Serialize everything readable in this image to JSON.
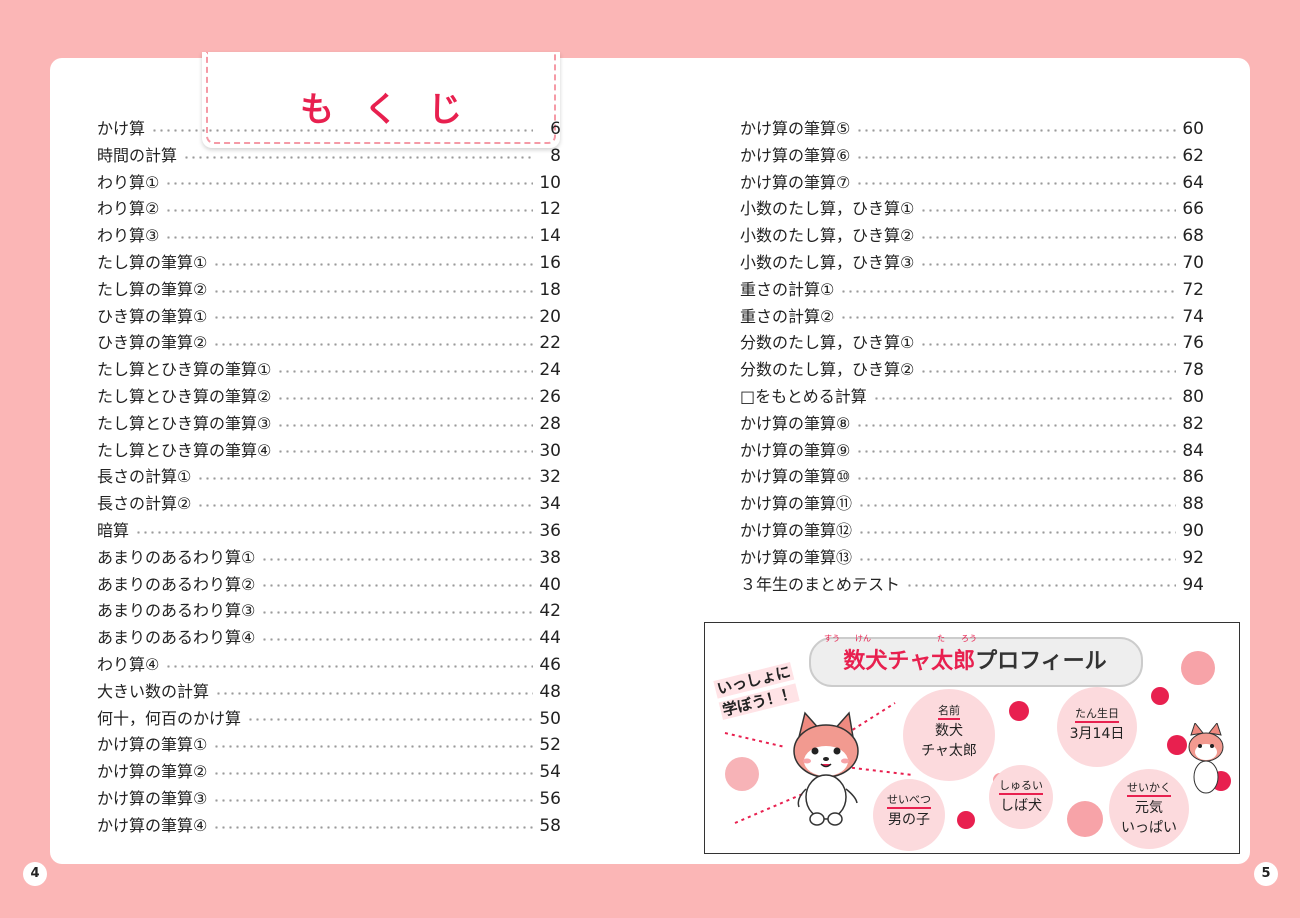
{
  "title": "もくじ",
  "left_page_number": "4",
  "right_page_number": "5",
  "toc_left": [
    {
      "label": "かけ算",
      "page": "6"
    },
    {
      "label": "時間の計算",
      "page": "8"
    },
    {
      "label": "わり算①",
      "page": "10"
    },
    {
      "label": "わり算②",
      "page": "12"
    },
    {
      "label": "わり算③",
      "page": "14"
    },
    {
      "label": "たし算の筆算①",
      "page": "16"
    },
    {
      "label": "たし算の筆算②",
      "page": "18"
    },
    {
      "label": "ひき算の筆算①",
      "page": "20"
    },
    {
      "label": "ひき算の筆算②",
      "page": "22"
    },
    {
      "label": "たし算とひき算の筆算①",
      "page": "24"
    },
    {
      "label": "たし算とひき算の筆算②",
      "page": "26"
    },
    {
      "label": "たし算とひき算の筆算③",
      "page": "28"
    },
    {
      "label": "たし算とひき算の筆算④",
      "page": "30"
    },
    {
      "label": "長さの計算①",
      "page": "32"
    },
    {
      "label": "長さの計算②",
      "page": "34"
    },
    {
      "label": "暗算",
      "page": "36"
    },
    {
      "label": "あまりのあるわり算①",
      "page": "38"
    },
    {
      "label": "あまりのあるわり算②",
      "page": "40"
    },
    {
      "label": "あまりのあるわり算③",
      "page": "42"
    },
    {
      "label": "あまりのあるわり算④",
      "page": "44"
    },
    {
      "label": "わり算④",
      "page": "46"
    },
    {
      "label": "大きい数の計算",
      "page": "48"
    },
    {
      "label": "何十，何百のかけ算",
      "page": "50"
    },
    {
      "label": "かけ算の筆算①",
      "page": "52"
    },
    {
      "label": "かけ算の筆算②",
      "page": "54"
    },
    {
      "label": "かけ算の筆算③",
      "page": "56"
    },
    {
      "label": "かけ算の筆算④",
      "page": "58"
    }
  ],
  "toc_right": [
    {
      "label": "かけ算の筆算⑤",
      "page": "60"
    },
    {
      "label": "かけ算の筆算⑥",
      "page": "62"
    },
    {
      "label": "かけ算の筆算⑦",
      "page": "64"
    },
    {
      "label": "小数のたし算，ひき算①",
      "page": "66"
    },
    {
      "label": "小数のたし算，ひき算②",
      "page": "68"
    },
    {
      "label": "小数のたし算，ひき算③",
      "page": "70"
    },
    {
      "label": "重さの計算①",
      "page": "72"
    },
    {
      "label": "重さの計算②",
      "page": "74"
    },
    {
      "label": "分数のたし算，ひき算①",
      "page": "76"
    },
    {
      "label": "分数のたし算，ひき算②",
      "page": "78"
    },
    {
      "label": "□をもとめる計算",
      "page": "80"
    },
    {
      "label": "かけ算の筆算⑧",
      "page": "82"
    },
    {
      "label": "かけ算の筆算⑨",
      "page": "84"
    },
    {
      "label": "かけ算の筆算⑩",
      "page": "86"
    },
    {
      "label": "かけ算の筆算⑪",
      "page": "88"
    },
    {
      "label": "かけ算の筆算⑫",
      "page": "90"
    },
    {
      "label": "かけ算の筆算⑬",
      "page": "92"
    },
    {
      "label": "３年生のまとめテスト",
      "page": "94"
    }
  ],
  "profile": {
    "title_red": "数犬チャ太郎",
    "title_black": "プロフィール",
    "ruby": [
      "すう",
      "けん",
      "た",
      "ろう"
    ],
    "slogan_line1": "いっしょに",
    "slogan_line2": "学ぼう！！",
    "name_caption": "名前",
    "name_line1": "数犬",
    "name_line2": "チャ太郎",
    "birthday_caption": "たん生日",
    "birthday_value": "3月14日",
    "gender_caption": "せいべつ",
    "gender_value": "男の子",
    "breed_caption": "しゅるい",
    "breed_value": "しば犬",
    "personality_caption": "せいかく",
    "personality_line1": "元気",
    "personality_line2": "いっぱい"
  },
  "colors": {
    "background_pink": "#fbb6b6",
    "accent_red": "#e8204f",
    "bubble_pink": "#fcdadd"
  }
}
